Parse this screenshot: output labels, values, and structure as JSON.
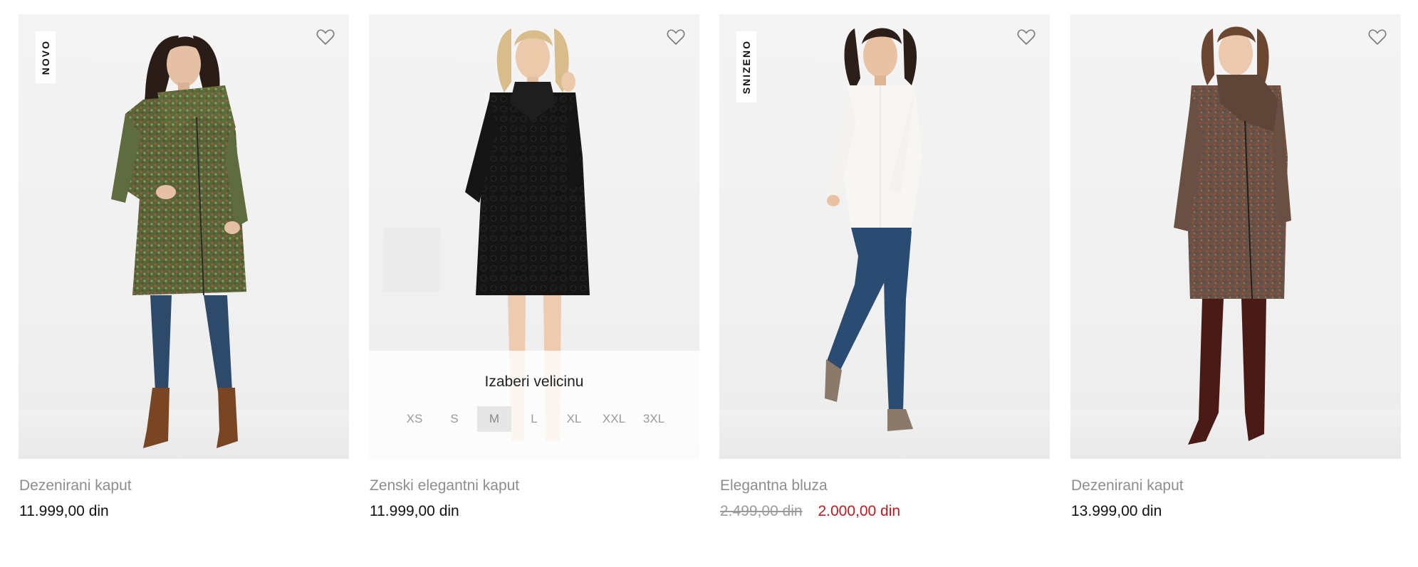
{
  "products": [
    {
      "name": "Dezenirani kaput",
      "price": "11.999,00 din",
      "badge": "NOVO",
      "image": "woman in green tweed coat"
    },
    {
      "name": "Zenski elegantni kaput",
      "price": "11.999,00 din",
      "image": "woman in black lace coat",
      "size_selector": {
        "title": "Izaberi velicinu",
        "sizes": [
          "XS",
          "S",
          "M",
          "L",
          "XL",
          "XXL",
          "3XL"
        ],
        "highlighted": "M"
      }
    },
    {
      "name": "Elegantna bluza",
      "old_price": "2.499,00 din",
      "sale_price": "2.000,00 din",
      "badge": "SNIZENO",
      "image": "woman in white blouse and jeans"
    },
    {
      "name": "Dezenirani kaput",
      "price": "13.999,00 din",
      "image": "woman in brown tweed coat and boots"
    }
  ],
  "icons": {
    "wishlist": "heart-outline-icon"
  },
  "colors": {
    "sale_price": "#c8161d",
    "name_text": "#8d8d8d",
    "price_text": "#111111"
  }
}
